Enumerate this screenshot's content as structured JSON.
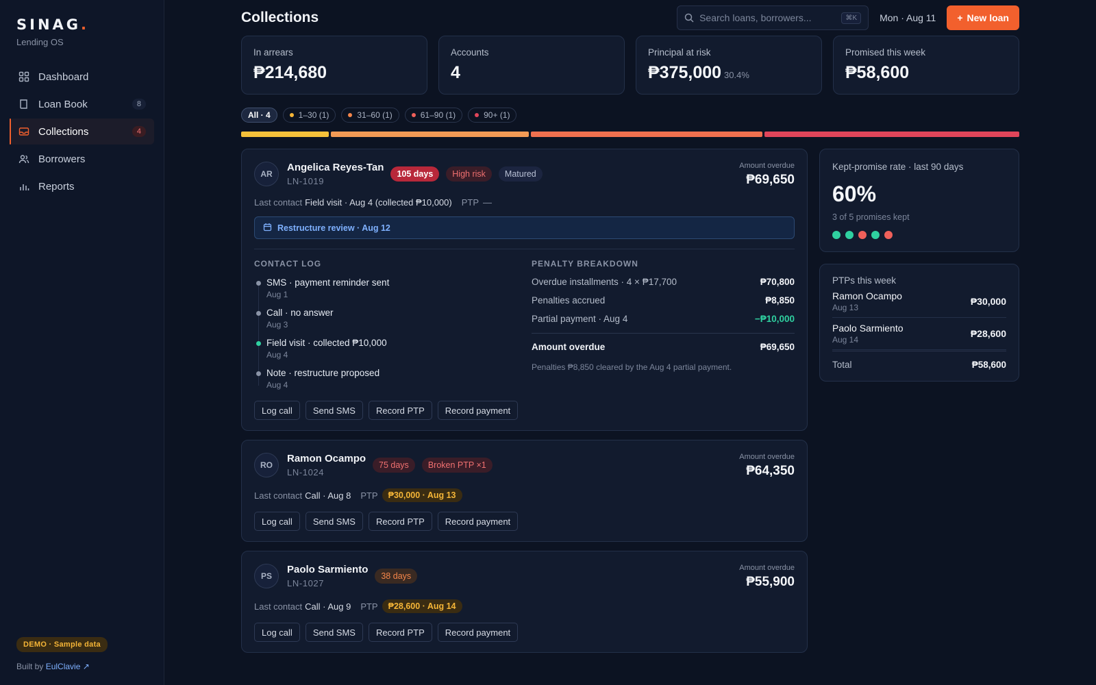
{
  "brand": {
    "name": "SINAG",
    "dot": ".",
    "subtitle": "Lending OS"
  },
  "nav": [
    {
      "label": "Dashboard",
      "icon": "grid-icon",
      "count": ""
    },
    {
      "label": "Loan Book",
      "icon": "book-icon",
      "count": "8"
    },
    {
      "label": "Collections",
      "icon": "inbox-icon",
      "count": "4",
      "active": true
    },
    {
      "label": "Borrowers",
      "icon": "users-icon",
      "count": ""
    },
    {
      "label": "Reports",
      "icon": "bar-chart-icon",
      "count": ""
    }
  ],
  "footer": {
    "demo": "DEMO · Sample data",
    "built_prefix": "Built by",
    "built_link": "EulClavie ↗"
  },
  "header": {
    "title": "Collections",
    "search_placeholder": "Search loans, borrowers...",
    "shortcut": "⌘K",
    "date": "Mon · Aug 11",
    "new_loan": "New loan",
    "new_loan_icon": "+"
  },
  "stats": [
    {
      "label": "In arrears",
      "value": "₱214,680",
      "sub": ""
    },
    {
      "label": "Accounts",
      "value": "4",
      "sub": ""
    },
    {
      "label": "Principal at risk",
      "value": "₱375,000",
      "sub": "30.4%"
    },
    {
      "label": "Promised this week",
      "value": "₱58,600",
      "sub": ""
    }
  ],
  "filters": [
    {
      "label": "All · 4",
      "color": "",
      "active": true
    },
    {
      "label": "1–30 (1)",
      "color": "#f5b537"
    },
    {
      "label": "31–60 (1)",
      "color": "#f5864a"
    },
    {
      "label": "61–90 (1)",
      "color": "#f0605a"
    },
    {
      "label": "90+ (1)",
      "color": "#e0455a"
    }
  ],
  "aging_bar": [
    {
      "fraction": 0.114,
      "color": "#f5c13a"
    },
    {
      "fraction": 0.256,
      "color": "#f29a55"
    },
    {
      "fraction": 0.3,
      "color": "#f0704f"
    },
    {
      "fraction": 0.33,
      "color": "#e0455a"
    }
  ],
  "accounts": [
    {
      "initials": "AR",
      "name": "Angelica Reyes-Tan",
      "loan": "LN-1019",
      "badges": [
        {
          "text": "105 days",
          "kind": "b-red"
        },
        {
          "text": "High risk",
          "kind": "b-redt"
        },
        {
          "text": "Matured",
          "kind": "b-mat"
        }
      ],
      "amount_label": "Amount overdue",
      "amount": "₱69,650",
      "last_contact_label": "Last contact",
      "last_contact": "Field visit · Aug 4 (collected ₱10,000)",
      "ptp_label": "PTP",
      "ptp": "—",
      "restructure": "Restructure review · Aug 12",
      "contact_log_title": "CONTACT LOG",
      "contact_log": [
        {
          "title": "SMS · payment reminder sent",
          "date": "Aug 1",
          "color": "#8a93a6"
        },
        {
          "title": "Call · no answer",
          "date": "Aug 3",
          "color": "#8a93a6"
        },
        {
          "title": "Field visit · collected ₱10,000",
          "date": "Aug 4",
          "color": "#2fd0a0"
        },
        {
          "title": "Note · restructure proposed",
          "date": "Aug 4",
          "color": "#8a93a6"
        }
      ],
      "penalty_title": "PENALTY BREAKDOWN",
      "penalty": [
        {
          "label": "Overdue installments · 4 × ₱17,700",
          "value": "₱70,800"
        },
        {
          "label": "Penalties accrued",
          "value": "₱8,850"
        },
        {
          "label": "Partial payment · Aug 4",
          "value": "−₱10,000",
          "color": "#2fd0a0"
        }
      ],
      "penalty_total_label": "Amount overdue",
      "penalty_total": "₱69,650",
      "penalty_note": "Penalties ₱8,850 cleared by the Aug 4 partial payment."
    },
    {
      "initials": "RO",
      "name": "Ramon Ocampo",
      "loan": "LN-1024",
      "badges": [
        {
          "text": "75 days",
          "kind": "b-redt"
        },
        {
          "text": "Broken PTP ×1",
          "kind": "b-redt"
        }
      ],
      "amount_label": "Amount overdue",
      "amount": "₱64,350",
      "last_contact_label": "Last contact",
      "last_contact": "Call · Aug 8",
      "ptp_label": "PTP",
      "ptp": "₱30,000 · Aug 13"
    },
    {
      "initials": "PS",
      "name": "Paolo Sarmiento",
      "loan": "LN-1027",
      "badges": [
        {
          "text": "38 days",
          "kind": "b-ora"
        }
      ],
      "amount_label": "Amount overdue",
      "amount": "₱55,900",
      "last_contact_label": "Last contact",
      "last_contact": "Call · Aug 9",
      "ptp_label": "PTP",
      "ptp": "₱28,600 · Aug 14"
    }
  ],
  "actions": [
    "Log call",
    "Send SMS",
    "Record PTP",
    "Record payment"
  ],
  "kept": {
    "label": "Kept-promise rate · last 90 days",
    "value": "60%",
    "sub": "3 of 5 promises kept",
    "dots": [
      "#2fd0a0",
      "#2fd0a0",
      "#f0605a",
      "#2fd0a0",
      "#f0605a"
    ]
  },
  "ptps": {
    "label": "PTPs this week",
    "rows": [
      {
        "name": "Ramon Ocampo",
        "date": "Aug 13",
        "value": "₱30,000"
      },
      {
        "name": "Paolo Sarmiento",
        "date": "Aug 14",
        "value": "₱28,600"
      }
    ],
    "total_label": "Total",
    "total": "₱58,600"
  }
}
